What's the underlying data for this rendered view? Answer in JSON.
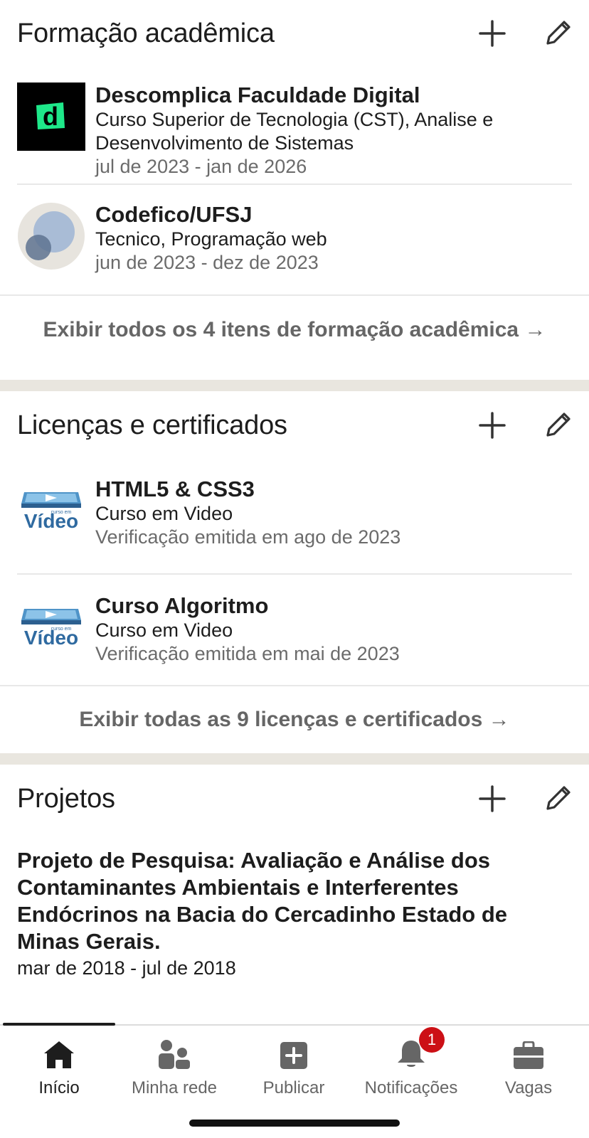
{
  "education": {
    "title": "Formação acadêmica",
    "items": [
      {
        "school": "Descomplica Faculdade Digital",
        "degree": "Curso Superior de Tecnologia (CST), Analise e Desenvolvimento de Sistemas",
        "dates": "jul de 2023 - jan de 2026",
        "logo_letter": "d"
      },
      {
        "school": "Codefico/UFSJ",
        "degree": "Tecnico, Programação web",
        "dates": "jun de 2023 - dez de 2023"
      }
    ],
    "show_all": "Exibir todos os 4 itens de formação acadêmica →"
  },
  "licenses": {
    "title": "Licenças e certificados",
    "items": [
      {
        "name": "HTML5 & CSS3",
        "issuer": "Curso em Video",
        "issued": "Verificação emitida em ago de 2023"
      },
      {
        "name": "Curso Algoritmo",
        "issuer": "Curso em Video",
        "issued": "Verificação emitida em mai de 2023"
      }
    ],
    "show_all": "Exibir todas as 9 licenças e certificados →"
  },
  "projects": {
    "title": "Projetos",
    "items": [
      {
        "name": "Projeto de Pesquisa: Avaliação e Análise dos Contaminantes Ambientais e Interferentes Endócrinos na Bacia do Cercadinho Estado de Minas Gerais.",
        "dates": "mar de 2018 - jul de 2018"
      }
    ]
  },
  "bottom_nav": {
    "items": [
      {
        "label": "Início",
        "icon": "home-icon",
        "active": true
      },
      {
        "label": "Minha rede",
        "icon": "network-icon"
      },
      {
        "label": "Publicar",
        "icon": "post-icon"
      },
      {
        "label": "Notificações",
        "icon": "bell-icon",
        "badge": "1"
      },
      {
        "label": "Vagas",
        "icon": "briefcase-icon"
      }
    ]
  },
  "colors": {
    "background": "#ffffff",
    "separator": "#e9e6df",
    "text": "#1d1d1d",
    "muted": "#6b6b6b",
    "badge": "#cc1016",
    "descomplica_green": "#1ee88a"
  }
}
